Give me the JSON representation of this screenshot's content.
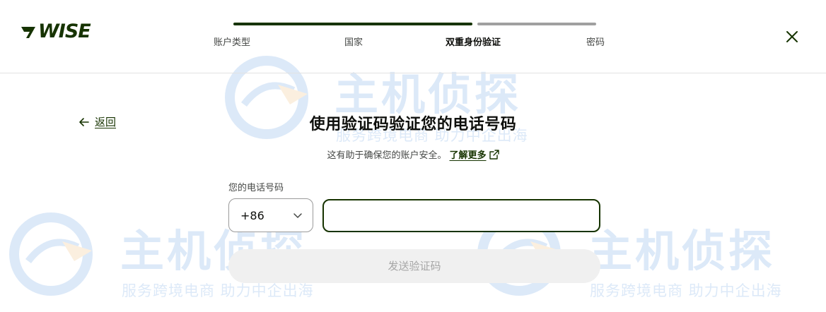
{
  "brand": {
    "name": "WISE",
    "logo_color": "#163300"
  },
  "stepper": {
    "steps": [
      "账户类型",
      "国家",
      "双重身份验证",
      "密码"
    ],
    "active_index": 2,
    "progress_fraction": 0.67
  },
  "header": {
    "close_icon": "close-icon"
  },
  "back": {
    "label": "返回",
    "icon": "arrow-left-icon"
  },
  "main": {
    "title": "使用验证码验证您的电话号码",
    "subtitle": "这有助于确保您的账户安全。",
    "learn_more": "了解更多",
    "learn_more_icon": "external-link-icon"
  },
  "form": {
    "phone_label": "您的电话号码",
    "country_code": "+86",
    "phone_value": "",
    "phone_placeholder": "",
    "send_button": "发送验证码"
  },
  "watermark": {
    "title": "主机侦探",
    "slogan": "服务跨境电商 助力中企出海"
  },
  "colors": {
    "accent": "#163300",
    "muted_bar": "#a0a0a0",
    "disabled_bg": "#f0f0f0",
    "watermark": "#2f7bd6"
  }
}
